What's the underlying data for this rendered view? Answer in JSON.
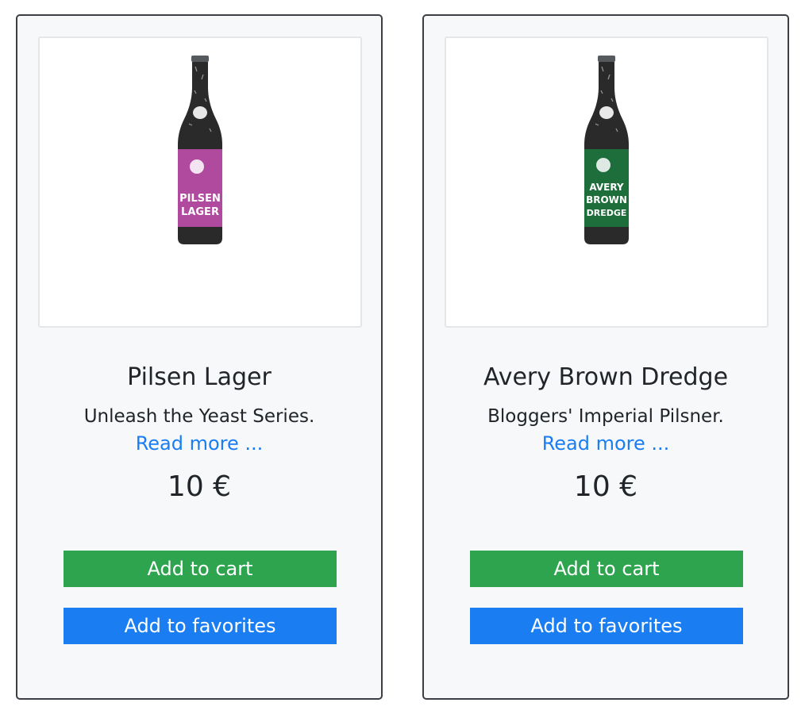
{
  "products": [
    {
      "name": "Pilsen Lager",
      "tagline": "Unleash the Yeast Series.",
      "read_more": "Read more ...",
      "price": "10 €",
      "add_to_cart": "Add to cart",
      "add_to_favorites": "Add to favorites",
      "label_color": "#b04a9e",
      "label_text_lines": [
        "PILSEN",
        "LAGER"
      ]
    },
    {
      "name": "Avery Brown Dredge",
      "tagline": "Bloggers' Imperial Pilsner.",
      "read_more": "Read more ...",
      "price": "10 €",
      "add_to_cart": "Add to cart",
      "add_to_favorites": "Add to favorites",
      "label_color": "#1e6e3c",
      "label_text_lines": [
        "AVERY",
        "BROWN",
        "DREDGE"
      ]
    }
  ],
  "colors": {
    "cart_button": "#2ea44f",
    "favorites_button": "#1a7ef2",
    "link": "#1a7ef2"
  }
}
